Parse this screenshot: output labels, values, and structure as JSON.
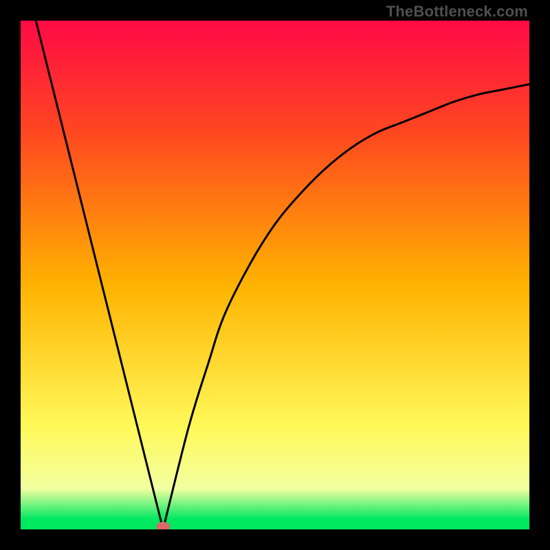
{
  "watermark": "TheBottleneck.com",
  "colors": {
    "top": "#ff0a46",
    "q1": "#ff4720",
    "mid": "#ffb300",
    "q3": "#fff95a",
    "lowerBand": "#f2ffa0",
    "bottom": "#00e760",
    "curve": "#000000",
    "marker": "#d96868",
    "frame": "#000000"
  },
  "chart_data": {
    "type": "line",
    "title": "",
    "xlabel": "",
    "ylabel": "",
    "xlim": [
      0,
      1
    ],
    "ylim": [
      0,
      1
    ],
    "grid": false,
    "legend": false,
    "series": [
      {
        "name": "left-branch",
        "x": [
          0.03,
          0.28
        ],
        "y": [
          1.0,
          0.0
        ]
      },
      {
        "name": "right-branch",
        "x": [
          0.28,
          0.33,
          0.37,
          0.4,
          0.45,
          0.5,
          0.55,
          0.6,
          0.65,
          0.7,
          0.75,
          0.8,
          0.85,
          0.9,
          0.95,
          1.0
        ],
        "y": [
          0.0,
          0.2,
          0.33,
          0.42,
          0.52,
          0.6,
          0.66,
          0.71,
          0.75,
          0.78,
          0.8,
          0.82,
          0.84,
          0.855,
          0.865,
          0.875
        ]
      }
    ],
    "marker": {
      "x": 0.28,
      "y": 0.0
    }
  }
}
